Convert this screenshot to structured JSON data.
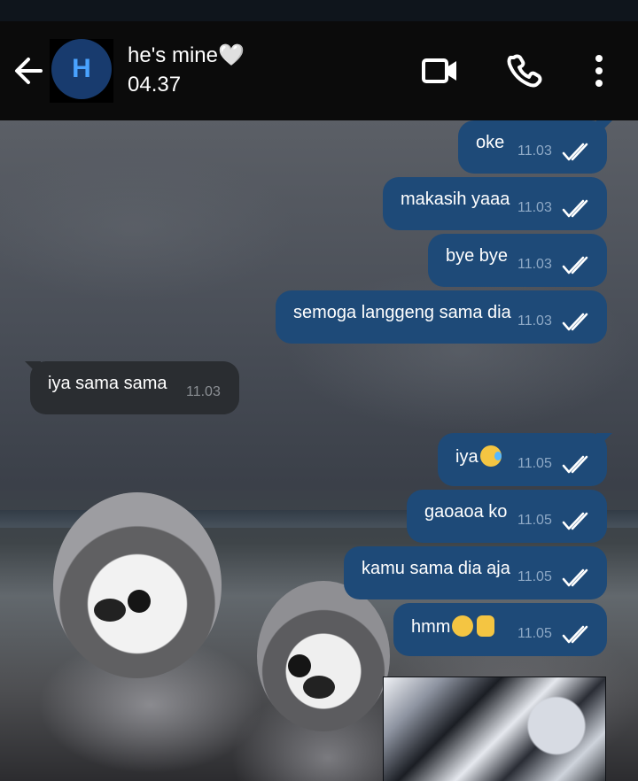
{
  "header": {
    "contact_name": "he's mine🤍",
    "subtitle": "04.37",
    "avatar_initial": "H",
    "icons": [
      "back-arrow-icon",
      "video-call-icon",
      "phone-icon",
      "more-vert-icon"
    ]
  },
  "messages": [
    {
      "text": "oke",
      "time": "11.03",
      "direction": "outgoing",
      "status": "read"
    },
    {
      "text": "makasih yaaa",
      "time": "11.03",
      "direction": "outgoing",
      "status": "read"
    },
    {
      "text": "bye bye",
      "time": "11.03",
      "direction": "outgoing",
      "status": "read"
    },
    {
      "text": "semoga langgeng sama dia",
      "time": "11.03",
      "direction": "outgoing",
      "status": "read"
    },
    {
      "text": "iya sama sama",
      "time": "11.03",
      "direction": "incoming"
    },
    {
      "text": "iya",
      "time": "11.05",
      "direction": "outgoing",
      "status": "read",
      "emoji": "crying-face"
    },
    {
      "text": "gaoaoa ko",
      "time": "11.05",
      "direction": "outgoing",
      "status": "read"
    },
    {
      "text": "kamu sama dia aja",
      "time": "11.05",
      "direction": "outgoing",
      "status": "read"
    },
    {
      "text": "hmm",
      "time": "11.05",
      "direction": "outgoing",
      "status": "read",
      "emoji": "sweat-smile-face thumbs-up"
    }
  ],
  "colors": {
    "header_bg": "#0b0b0b",
    "outgoing_bubble": "#1e4a78",
    "incoming_bubble": "#2a2d31",
    "avatar_bg": "#183b6e",
    "avatar_text": "#4aa3ff"
  }
}
